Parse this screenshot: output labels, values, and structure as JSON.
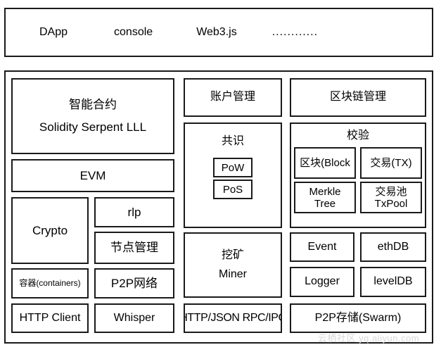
{
  "app_layer": {
    "items": [
      {
        "label": "DApp"
      },
      {
        "label": "console"
      },
      {
        "label": "Web3.js"
      },
      {
        "label": "............"
      }
    ]
  },
  "platform": {
    "left_column": {
      "smart_contract": {
        "title": "智能合约",
        "languages": "Solidity  Serpent  LLL"
      },
      "evm": "EVM",
      "crypto": "Crypto",
      "rlp": "rlp",
      "node_management": "节点管理",
      "containers": "容器(containers)",
      "p2p_network": "P2P网络",
      "http_client": "HTTP Client",
      "whisper": "Whisper"
    },
    "middle_column": {
      "account_management": "账户管理",
      "consensus": {
        "title": "共识",
        "pow": "PoW",
        "pos": "PoS"
      },
      "miner": {
        "cn": "挖矿",
        "en": "Miner"
      },
      "rpc": "HTTP/JSON RPC/IPC"
    },
    "right_column": {
      "blockchain_management": "区块链管理",
      "validation": {
        "title": "校验",
        "cells": [
          {
            "line1": "区块(Block",
            "line2": ""
          },
          {
            "line1": "交易(TX)",
            "line2": ""
          },
          {
            "line1": "Merkle",
            "line2": "Tree"
          },
          {
            "line1": "交易池",
            "line2": "TxPool"
          }
        ]
      },
      "event": "Event",
      "ethdb": "ethDB",
      "logger": "Logger",
      "leveldb": "levelDB",
      "swarm": "P2P存储(Swarm)"
    }
  },
  "watermark": "云栖社区 yq.aliyun.com"
}
